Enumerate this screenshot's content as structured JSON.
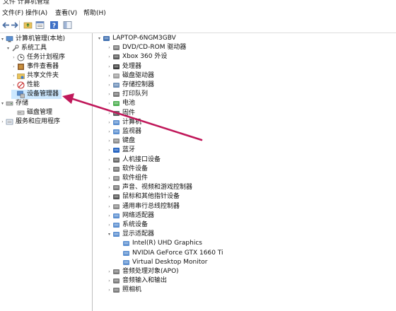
{
  "topstrip_text": "文件 计算机管理",
  "menu": [
    {
      "label": "文件(F)"
    },
    {
      "label": "操作(A)"
    },
    {
      "label": "查看(V)"
    },
    {
      "label": "帮助(H)"
    }
  ],
  "toolbar": {
    "icons": [
      "back-arrow-icon",
      "forward-arrow-icon",
      "folder-up-icon",
      "properties-icon",
      "help-icon",
      "show-hide-icon"
    ]
  },
  "left_tree": {
    "root": "计算机管理(本地)",
    "items": [
      {
        "label": "系统工具"
      },
      {
        "label": "任务计划程序"
      },
      {
        "label": "事件查看器"
      },
      {
        "label": "共享文件夹"
      },
      {
        "label": "性能"
      },
      {
        "label": "设备管理器"
      },
      {
        "label": "存储"
      },
      {
        "label": "磁盘管理"
      },
      {
        "label": "服务和应用程序"
      }
    ]
  },
  "device_tree": {
    "computer": "LAPTOP-6NGM3GBV",
    "categories": [
      {
        "label": "DVD/CD-ROM 驱动器"
      },
      {
        "label": "Xbox 360 外设"
      },
      {
        "label": "处理器"
      },
      {
        "label": "磁盘驱动器"
      },
      {
        "label": "存储控制器"
      },
      {
        "label": "打印队列"
      },
      {
        "label": "电池"
      },
      {
        "label": "固件"
      },
      {
        "label": "计算机"
      },
      {
        "label": "监视器"
      },
      {
        "label": "键盘"
      },
      {
        "label": "蓝牙"
      },
      {
        "label": "人机接口设备"
      },
      {
        "label": "软件设备"
      },
      {
        "label": "软件组件"
      },
      {
        "label": "声音、视频和游戏控制器"
      },
      {
        "label": "鼠标和其他指针设备"
      },
      {
        "label": "通用串行总线控制器"
      },
      {
        "label": "网络适配器"
      },
      {
        "label": "系统设备"
      },
      {
        "label": "显示适配器"
      }
    ],
    "display_adapters": [
      {
        "label": "Intel(R) UHD Graphics"
      },
      {
        "label": "NVIDIA GeForce GTX 1660 Ti"
      },
      {
        "label": "Virtual Desktop Monitor"
      }
    ],
    "after": [
      {
        "label": "音频处理对象(APO)"
      },
      {
        "label": "音频输入和输出"
      },
      {
        "label": "照相机"
      }
    ]
  },
  "colors": {
    "annotation_arrow": "#c0185a",
    "selection": "#cce8ff"
  }
}
